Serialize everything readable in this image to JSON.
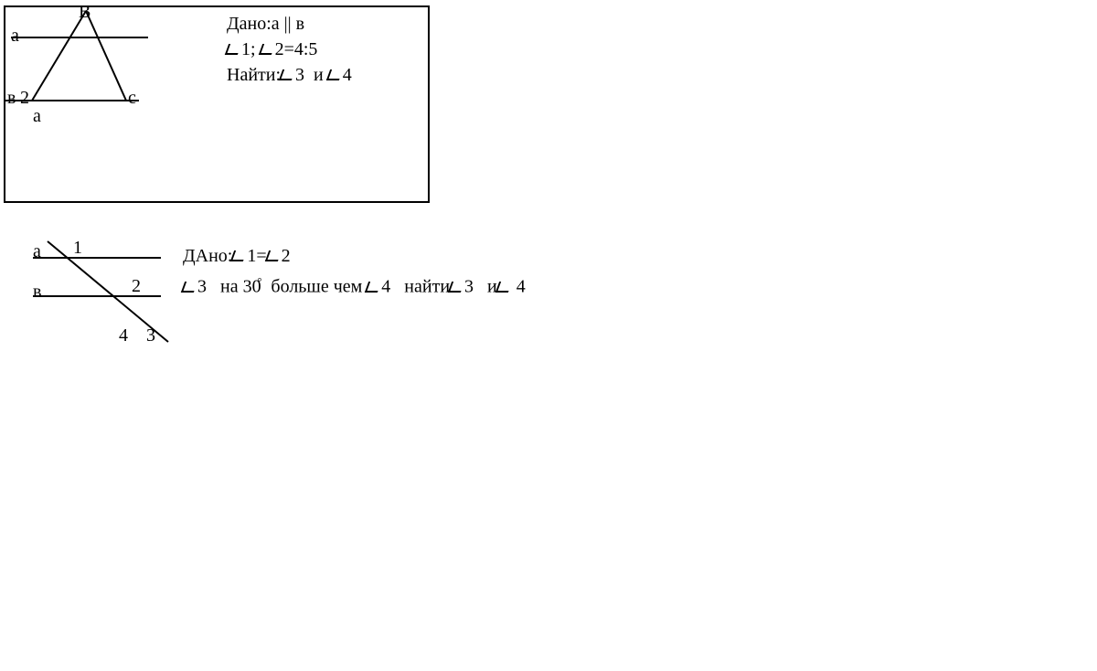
{
  "problem1": {
    "diagram": {
      "vertexB": "В",
      "lineA": "а",
      "lineB": "в",
      "angle2": "2",
      "pointA": "а",
      "pointC": "с"
    },
    "given_label": "Дано:",
    "given_parallel": "а || в",
    "angle_ratio_l": "1;",
    "angle_ratio_r": "2=4:5",
    "find_label": "Найти:",
    "find_a3": "3",
    "find_and": "и",
    "find_a4": "4"
  },
  "problem2": {
    "diagram": {
      "lineA": "а",
      "lineB": "в",
      "angle1": "1",
      "angle2": "2",
      "angle3": "3",
      "angle4": "4"
    },
    "given_label": "ДАно:",
    "given_eq_l": "1=",
    "given_eq_r": "2",
    "line2_a3": "3",
    "line2_mid": "на 30",
    "line2_deg": "°",
    "line2_more": "больше чем",
    "line2_a4": "4",
    "line2_find": "найти",
    "line2_f3": "3",
    "line2_and": "и",
    "line2_f4": "4"
  }
}
